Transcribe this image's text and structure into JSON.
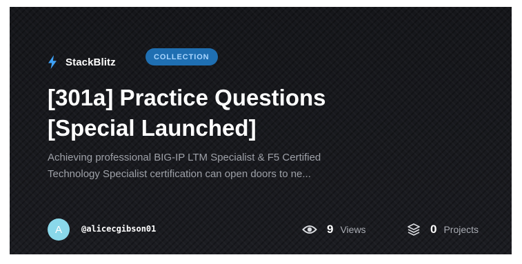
{
  "brand": {
    "name": "StackBlitz",
    "icon": "bolt-icon"
  },
  "badge": {
    "label": "COLLECTION"
  },
  "title": {
    "line1": "[301a] Practice Questions",
    "line2": "[Special Launched]"
  },
  "description": {
    "line1": "Achieving professional BIG-IP LTM Specialist & F5 Certified",
    "line2": "Technology Specialist certification can open doors to ne..."
  },
  "author": {
    "initial": "A",
    "username": "@alicecgibson01"
  },
  "stats": {
    "views": {
      "count": "9",
      "label": "Views",
      "icon": "eye-icon"
    },
    "projects": {
      "count": "0",
      "label": "Projects",
      "icon": "layers-icon"
    }
  },
  "colors": {
    "accent": "#1f6fb2",
    "brand_bolt": "#3fa2f7",
    "avatar": "#8ad8ea",
    "background": "#17181c"
  }
}
